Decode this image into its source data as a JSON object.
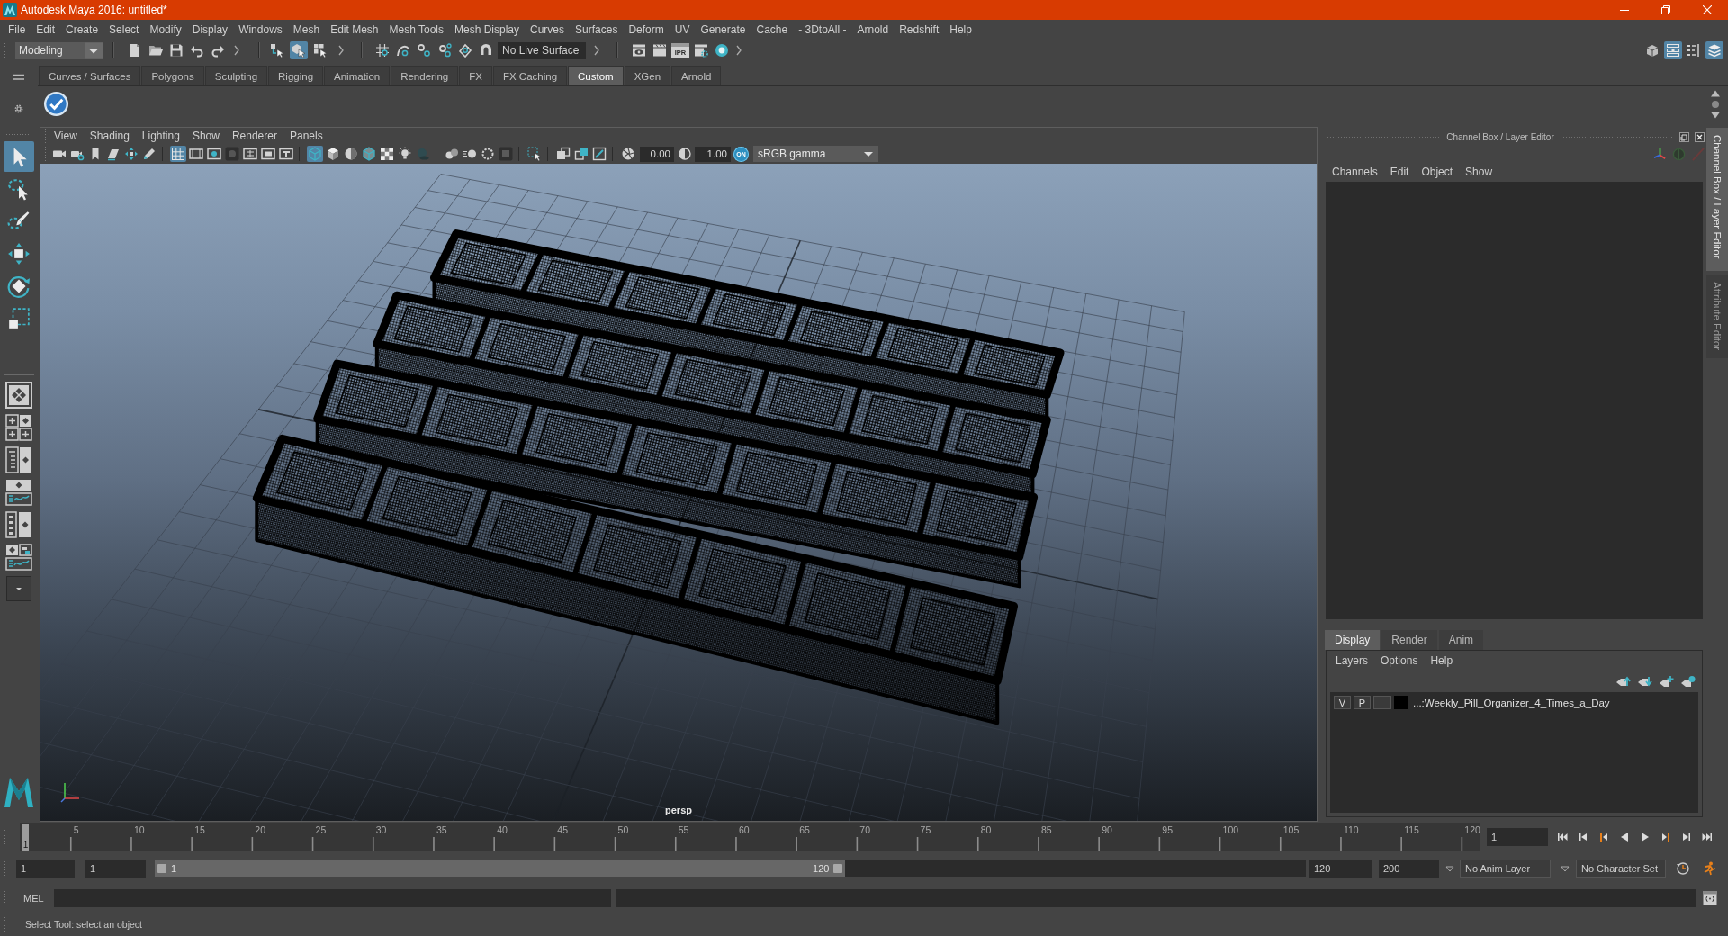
{
  "window": {
    "title": "Autodesk Maya 2016: untitled*"
  },
  "menu_bar": [
    "File",
    "Edit",
    "Create",
    "Select",
    "Modify",
    "Display",
    "Windows",
    "Mesh",
    "Edit Mesh",
    "Mesh Tools",
    "Mesh Display",
    "Curves",
    "Surfaces",
    "Deform",
    "UV",
    "Generate",
    "Cache",
    "- 3DtoAll -",
    "Arnold",
    "Redshift",
    "Help"
  ],
  "status_line": {
    "mode": "Modeling",
    "selection_mask": [
      {
        "kind": "hierarchy",
        "selected": false
      },
      {
        "kind": "object",
        "selected": true
      },
      {
        "kind": "component",
        "selected": false
      }
    ],
    "live_surface": "No Live Surface",
    "ipr_label": "IPR",
    "panel_toggles": [
      {
        "kind": "toolkit",
        "selected": false
      },
      {
        "kind": "attributes",
        "selected": true
      },
      {
        "kind": "toolsettings",
        "selected": false
      },
      {
        "kind": "channels",
        "selected": true
      }
    ]
  },
  "shelf": {
    "tabs": [
      {
        "label": "Curves / Surfaces",
        "selected": false
      },
      {
        "label": "Polygons",
        "selected": false
      },
      {
        "label": "Sculpting",
        "selected": false
      },
      {
        "label": "Rigging",
        "selected": false
      },
      {
        "label": "Animation",
        "selected": false
      },
      {
        "label": "Rendering",
        "selected": false
      },
      {
        "label": "FX",
        "selected": false
      },
      {
        "label": "FX Caching",
        "selected": false
      },
      {
        "label": "Custom",
        "selected": true
      },
      {
        "label": "XGen",
        "selected": false
      },
      {
        "label": "Arnold",
        "selected": false
      }
    ]
  },
  "toolbox": {
    "tools": [
      {
        "kind": "select",
        "selected": true
      },
      {
        "kind": "lasso",
        "selected": false
      },
      {
        "kind": "paint",
        "selected": false
      },
      {
        "kind": "move",
        "selected": false
      },
      {
        "kind": "rotate",
        "selected": false
      },
      {
        "kind": "scale",
        "selected": false
      }
    ]
  },
  "viewport": {
    "menu": [
      "View",
      "Shading",
      "Lighting",
      "Show",
      "Renderer",
      "Panels"
    ],
    "toolbar": [
      [
        {
          "kind": "camera",
          "on": false
        },
        {
          "kind": "camattr",
          "on": false
        },
        {
          "kind": "bookmark",
          "on": false
        },
        {
          "kind": "imageplane",
          "on": false
        },
        {
          "kind": "panzoom",
          "on": false
        },
        {
          "kind": "pencil",
          "on": false
        }
      ],
      [
        {
          "kind": "grid",
          "on": true
        },
        {
          "kind": "filmgate",
          "on": false
        },
        {
          "kind": "resgate",
          "on": false
        },
        {
          "kind": "gatemask",
          "on": false
        },
        {
          "kind": "fieldchart",
          "on": false
        },
        {
          "kind": "safeaction",
          "on": false
        },
        {
          "kind": "safetitle",
          "on": false
        }
      ],
      [
        {
          "kind": "wireframe",
          "on": true
        },
        {
          "kind": "smooth",
          "on": false
        },
        {
          "kind": "material",
          "on": false
        },
        {
          "kind": "wireshaded",
          "on": false
        },
        {
          "kind": "textured",
          "on": false
        },
        {
          "kind": "lights",
          "on": false
        },
        {
          "kind": "shadows",
          "on": false
        }
      ],
      [
        {
          "kind": "ssao",
          "on": false
        },
        {
          "kind": "motionblur",
          "on": false
        },
        {
          "kind": "aa",
          "on": false
        },
        {
          "kind": "dof",
          "on": false
        }
      ],
      [
        {
          "kind": "isolate",
          "on": false
        }
      ],
      [
        {
          "kind": "xray",
          "on": false
        },
        {
          "kind": "xrayjoint",
          "on": false
        },
        {
          "kind": "xraycomp",
          "on": false
        }
      ]
    ],
    "exposure": "0.00",
    "gamma": "1.00",
    "color_management": {
      "label": "ON",
      "on": true
    },
    "view_transform": "sRGB gamma",
    "camera_label": "persp"
  },
  "channel_box": {
    "title": "Channel Box / Layer Editor",
    "menu": [
      "Channels",
      "Edit",
      "Object",
      "Show"
    ]
  },
  "layer_editor": {
    "tabs": [
      {
        "label": "Display",
        "selected": true
      },
      {
        "label": "Render",
        "selected": false
      },
      {
        "label": "Anim",
        "selected": false
      }
    ],
    "menu": [
      "Layers",
      "Options",
      "Help"
    ],
    "layers": [
      {
        "visible": "V",
        "playback": "P",
        "name": "...:Weekly_Pill_Organizer_4_Times_a_Day",
        "color": "#000000"
      }
    ]
  },
  "side_tabs": [
    {
      "label": "Channel Box / Layer Editor",
      "selected": true
    },
    {
      "label": "Attribute Editor",
      "selected": false
    }
  ],
  "time_slider": {
    "tick_labels": [
      "5",
      "10",
      "15",
      "20",
      "25",
      "30",
      "35",
      "40",
      "45",
      "50",
      "55",
      "60",
      "65",
      "70",
      "75",
      "80",
      "85",
      "90",
      "95",
      "100",
      "105",
      "110",
      "115",
      "120"
    ],
    "marker_label": "1",
    "level": 0,
    "current_frame": "1"
  },
  "range_slider": {
    "start": "1",
    "playback_start": "1",
    "slider_start": "1",
    "slider_end": "120",
    "level": 0.6,
    "playback_end": "120",
    "end": "200",
    "anim_layer": "No Anim Layer",
    "character_set": "No Character Set"
  },
  "command_line": {
    "language": "MEL"
  },
  "help_line": "Select Tool: select an object"
}
